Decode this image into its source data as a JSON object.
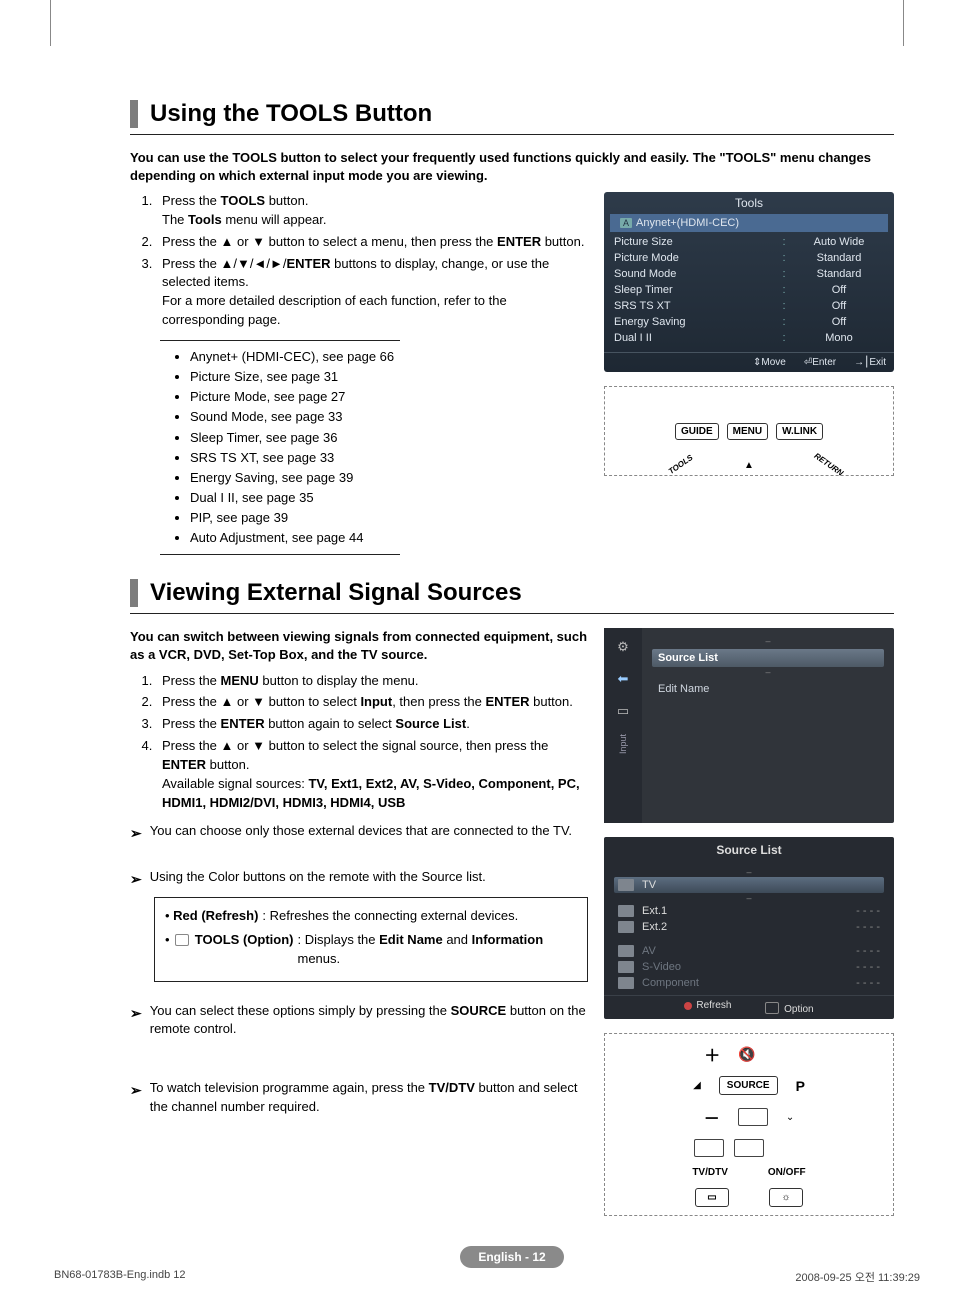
{
  "section1": {
    "title": "Using the TOOLS Button",
    "intro": "You can use the TOOLS button to select your frequently used functions quickly and easily. The \"TOOLS\" menu changes depending on which external input mode you are viewing.",
    "steps": [
      {
        "main": "Press the <b>TOOLS</b> button.",
        "sub": "The <b>Tools</b> menu will appear."
      },
      {
        "main": "Press the ▲ or ▼ button to select a menu, then press the <b>ENTER</b> button."
      },
      {
        "main": "Press the ▲/▼/◄/►/<b>ENTER</b> buttons to display, change, or use the selected items.",
        "sub": "For a more detailed description of each function, refer to the corresponding page."
      }
    ],
    "refs": [
      "Anynet+ (HDMI-CEC), see page 66",
      "Picture Size, see page 31",
      "Picture Mode, see page 27",
      "Sound Mode, see page 33",
      "Sleep Timer, see page 36",
      "SRS TS XT, see page 33",
      "Energy Saving, see page 39",
      "Dual I II, see page 35",
      "PIP, see page 39",
      "Auto Adjustment, see page 44"
    ],
    "osd": {
      "title": "Tools",
      "selected": "Anynet+(HDMI-CEC)",
      "rows": [
        {
          "label": "Picture Size",
          "value": "Auto Wide"
        },
        {
          "label": "Picture Mode",
          "value": "Standard"
        },
        {
          "label": "Sound Mode",
          "value": "Standard"
        },
        {
          "label": "Sleep Timer",
          "value": "Off"
        },
        {
          "label": "SRS TS XT",
          "value": "Off"
        },
        {
          "label": "Energy Saving",
          "value": "Off"
        },
        {
          "label": "Dual I II",
          "value": "Mono"
        }
      ],
      "footer": {
        "move": "Move",
        "enter": "Enter",
        "exit": "Exit"
      }
    },
    "remote": {
      "guide": "GUIDE",
      "menu": "MENU",
      "wlink": "W.LINK",
      "tools": "TOOLS",
      "return": "RETURN"
    }
  },
  "section2": {
    "title": "Viewing External Signal Sources",
    "intro": "You can switch between viewing signals from connected equipment, such as a VCR, DVD, Set-Top Box, and the TV source.",
    "steps": [
      {
        "main": "Press the <b>MENU</b> button to display the menu."
      },
      {
        "main": "Press the ▲ or ▼ button to select <b>Input</b>, then press the <b>ENTER</b> button."
      },
      {
        "main": "Press the <b>ENTER</b> button again to select <b>Source List</b>."
      },
      {
        "main": "Press the ▲ or ▼ button to select the signal source, then press the <b>ENTER</b> button.",
        "sub": "Available signal sources: <b>TV, Ext1, Ext2, AV, S-Video, Component, PC, HDMI1, HDMI2/DVI, HDMI3, HDMI4, USB</b>"
      }
    ],
    "note1": "You can choose only those external devices that are connected to the TV.",
    "note2": "Using the Color buttons on the remote with the Source list.",
    "colorbox": {
      "red_label": "Red (Refresh)",
      "red_text": ": Refreshes the connecting external devices.",
      "tools_label": "TOOLS (Option)",
      "tools_text": ": Displays the <b>Edit Name</b> and <b>Information</b> menus."
    },
    "note3": "You can select these options simply by pressing the <b>SOURCE</b> button on the remote control.",
    "note4": "To watch television programme again, press the <b>TV/DTV</b> button and select the channel number required.",
    "input_panel": {
      "vlabel": "Input",
      "item1": "Source List",
      "item2": "Edit Name"
    },
    "src_panel": {
      "title": "Source List",
      "rows": [
        {
          "name": "TV",
          "dash": "",
          "sel": true
        },
        {
          "name": "Ext.1",
          "dash": "- - - -"
        },
        {
          "name": "Ext.2",
          "dash": "- - - -"
        },
        {
          "name": "AV",
          "dash": "- - - -",
          "dim": true
        },
        {
          "name": "S-Video",
          "dash": "- - - -",
          "dim": true
        },
        {
          "name": "Component",
          "dash": "- - - -",
          "dim": true
        }
      ],
      "footer": {
        "refresh": "Refresh",
        "option": "Option"
      }
    },
    "remote2": {
      "source": "SOURCE",
      "p": "P",
      "tvdtv": "TV/DTV",
      "onoff": "ON/OFF"
    }
  },
  "footer_label": "English - 12",
  "meta": {
    "file": "BN68-01783B-Eng.indb   12",
    "date": "2008-09-25   오전 11:39:29"
  }
}
